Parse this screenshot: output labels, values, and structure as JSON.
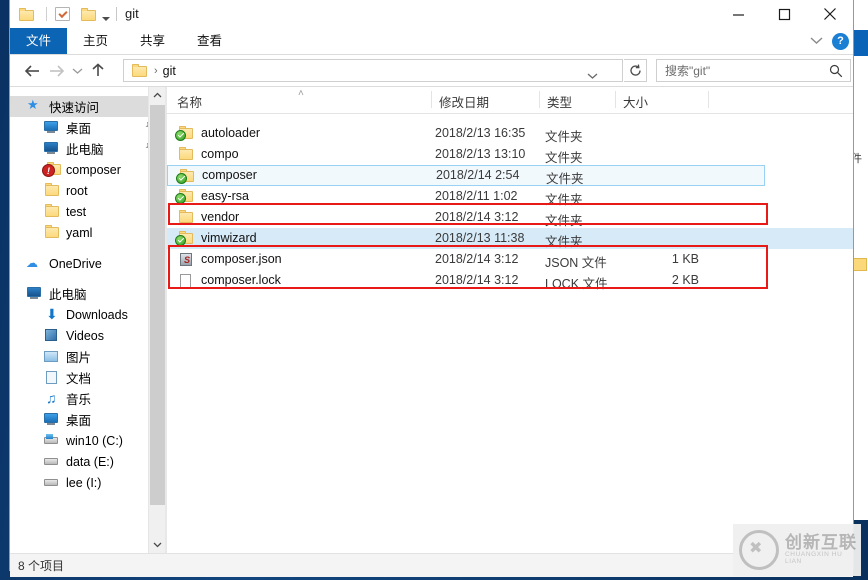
{
  "window": {
    "title": "git",
    "quick_access_icons": [
      "folder-icon",
      "properties-checkbox-icon",
      "folder-icon",
      "customize-caret-icon"
    ],
    "minimize_label": "—",
    "maximize_label": "□",
    "close_label": "✕"
  },
  "ribbon": {
    "tabs": [
      {
        "label": "文件",
        "active": true
      },
      {
        "label": "主页",
        "active": false
      },
      {
        "label": "共享",
        "active": false
      },
      {
        "label": "查看",
        "active": false
      }
    ],
    "collapse_icon": "chevron-down-icon",
    "help_label": "?"
  },
  "address": {
    "back_icon": "arrow-left-icon",
    "forward_icon": "arrow-right-icon",
    "recent_icon": "chevron-down-icon",
    "up_icon": "arrow-up-icon",
    "crumb_root_icon": "folder-icon",
    "crumb_separator": "›",
    "crumb_text": "git",
    "refresh_icon": "refresh-icon",
    "search_placeholder": "搜索\"git\"",
    "search_value": "",
    "search_icon": "magnifier-icon"
  },
  "sidebar": {
    "items": [
      {
        "label": "快速访问",
        "icon": "star-icon",
        "indent": 0,
        "selected": true,
        "pinned": false
      },
      {
        "label": "桌面",
        "icon": "desktop-icon",
        "indent": 1,
        "selected": false,
        "pinned": true
      },
      {
        "label": "此电脑",
        "icon": "computer-icon",
        "indent": 1,
        "selected": false,
        "pinned": true
      },
      {
        "label": "composer",
        "icon": "folder-warning-icon",
        "indent": 1,
        "selected": false,
        "pinned": false
      },
      {
        "label": "root",
        "icon": "folder-icon",
        "indent": 1,
        "selected": false,
        "pinned": false
      },
      {
        "label": "test",
        "icon": "folder-icon",
        "indent": 1,
        "selected": false,
        "pinned": false
      },
      {
        "label": "yaml",
        "icon": "folder-icon",
        "indent": 1,
        "selected": false,
        "pinned": false
      },
      {
        "label": "OneDrive",
        "icon": "onedrive-icon",
        "indent": 0,
        "selected": false,
        "pinned": false
      },
      {
        "label": "此电脑",
        "icon": "computer-icon",
        "indent": 0,
        "selected": false,
        "pinned": false
      },
      {
        "label": "Downloads",
        "icon": "downloads-icon",
        "indent": 1,
        "selected": false,
        "pinned": false
      },
      {
        "label": "Videos",
        "icon": "videos-icon",
        "indent": 1,
        "selected": false,
        "pinned": false
      },
      {
        "label": "图片",
        "icon": "pictures-icon",
        "indent": 1,
        "selected": false,
        "pinned": false
      },
      {
        "label": "文档",
        "icon": "documents-icon",
        "indent": 1,
        "selected": false,
        "pinned": false
      },
      {
        "label": "音乐",
        "icon": "music-icon",
        "indent": 1,
        "selected": false,
        "pinned": false
      },
      {
        "label": "桌面",
        "icon": "desktop-icon",
        "indent": 1,
        "selected": false,
        "pinned": false
      },
      {
        "label": "win10 (C:)",
        "icon": "windows-drive-icon",
        "indent": 1,
        "selected": false,
        "pinned": false
      },
      {
        "label": "data (E:)",
        "icon": "drive-icon",
        "indent": 1,
        "selected": false,
        "pinned": false
      },
      {
        "label": "lee (I:)",
        "icon": "drive-icon",
        "indent": 1,
        "selected": false,
        "pinned": false
      }
    ],
    "scroll_up_icon": "chevron-up-icon",
    "scroll_down_icon": "chevron-down-icon"
  },
  "filelist": {
    "columns": [
      {
        "label": "名称"
      },
      {
        "label": "修改日期"
      },
      {
        "label": "类型"
      },
      {
        "label": "大小"
      }
    ],
    "sort_indicator": "˄",
    "rows": [
      {
        "name": "autoloader",
        "date": "2018/2/13 16:35",
        "type": "文件夹",
        "size": "",
        "icon": "folder-synced-icon",
        "state": "none"
      },
      {
        "name": "compo",
        "date": "2018/2/13 13:10",
        "type": "文件夹",
        "size": "",
        "icon": "folder-icon",
        "state": "none"
      },
      {
        "name": "composer",
        "date": "2018/2/14 2:54",
        "type": "文件夹",
        "size": "",
        "icon": "folder-synced-icon",
        "state": "focused"
      },
      {
        "name": "easy-rsa",
        "date": "2018/2/11 1:02",
        "type": "文件夹",
        "size": "",
        "icon": "folder-synced-icon",
        "state": "none"
      },
      {
        "name": "vendor",
        "date": "2018/2/14 3:12",
        "type": "文件夹",
        "size": "",
        "icon": "folder-icon",
        "state": "none"
      },
      {
        "name": "vimwizard",
        "date": "2018/2/13 11:38",
        "type": "文件夹",
        "size": "",
        "icon": "folder-synced-icon",
        "state": "selected"
      },
      {
        "name": "composer.json",
        "date": "2018/2/14 3:12",
        "type": "JSON 文件",
        "size": "1 KB",
        "icon": "json-file-icon",
        "state": "none"
      },
      {
        "name": "composer.lock",
        "date": "2018/2/14 3:12",
        "type": "LOCK 文件",
        "size": "2 KB",
        "icon": "generic-file-icon",
        "state": "none"
      }
    ],
    "annotations": [
      {
        "name": "vendor-highlight"
      },
      {
        "name": "composer-files-highlight"
      }
    ],
    "annotation_color": "#e71a17"
  },
  "status": {
    "item_count_text": "8 个项目"
  },
  "watermark": {
    "cn": "创新互联",
    "en": "CHUANGXIN HU LIAN"
  },
  "colors": {
    "accent": "#0c64b4",
    "selection": "#d6eaf8",
    "annotation": "#e71a17"
  }
}
